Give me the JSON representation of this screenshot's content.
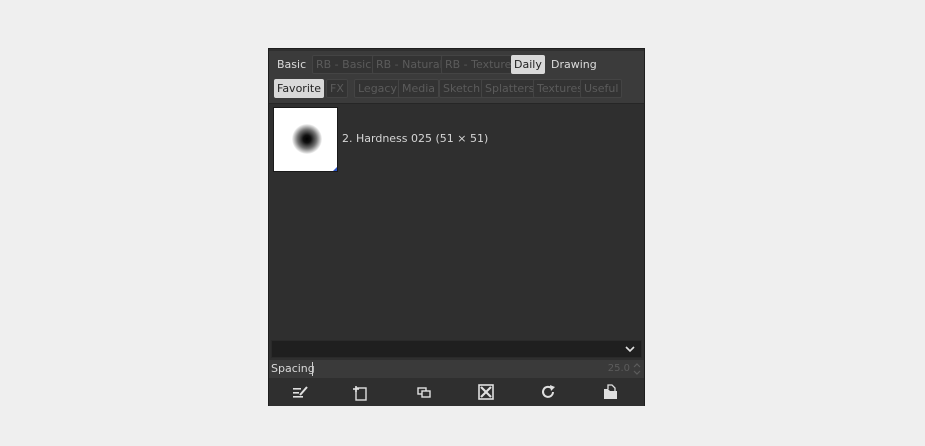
{
  "tags_row1": [
    {
      "label": "Basic",
      "state": "normal"
    },
    {
      "label": "RB - Basic",
      "state": "dim"
    },
    {
      "label": "RB - Natural",
      "state": "dim"
    },
    {
      "label": "RB - Texture",
      "state": "dim"
    },
    {
      "label": "Daily",
      "state": "active"
    },
    {
      "label": "Drawing",
      "state": "normal"
    }
  ],
  "tags_row2": [
    {
      "label": "Favorite",
      "state": "active"
    },
    {
      "label": "FX",
      "state": "dim"
    },
    {
      "label": "Legacy",
      "state": "dim"
    },
    {
      "label": "Media",
      "state": "dim"
    },
    {
      "label": "Sketch",
      "state": "dim"
    },
    {
      "label": "Splatters",
      "state": "dim"
    },
    {
      "label": "Textures",
      "state": "dim"
    },
    {
      "label": "Useful",
      "state": "dim"
    }
  ],
  "brush": {
    "name": "2. Hardness 025 (51 × 51)"
  },
  "spacing": {
    "label": "Spacing",
    "value": "25.0"
  },
  "toolbar_icons": [
    "edit-brush-icon",
    "new-brush-icon",
    "duplicate-brush-icon",
    "delete-brush-icon",
    "refresh-brushes-icon",
    "open-as-image-icon"
  ],
  "colors": {
    "panel": "#2f2f2f",
    "active_tag": "#d9d9d9",
    "text": "#dcdcdc",
    "accent": "#2d56c8"
  }
}
